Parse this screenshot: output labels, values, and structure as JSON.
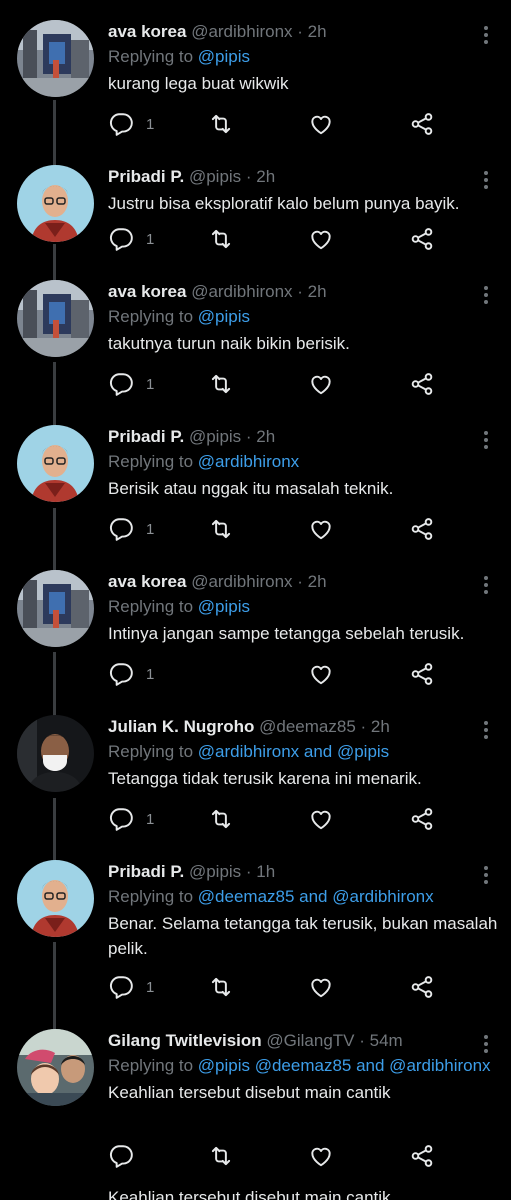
{
  "tweets": [
    {
      "name": "ava korea",
      "handle": "@ardibhironx",
      "sep": " · ",
      "time": "2h",
      "replying_prefix": "Replying to ",
      "replying_to": "@pipis",
      "text": "kurang lega buat wikwik",
      "reply_count": "1",
      "avatar": "street-photo"
    },
    {
      "name": "Pribadi P.",
      "handle": "@pipis",
      "sep": " · ",
      "time": "2h",
      "replying_prefix": "",
      "replying_to": "",
      "text": "Justru bisa eksploratif kalo belum punya bayik.",
      "reply_count": "1",
      "avatar": "man-glasses"
    },
    {
      "name": "ava korea",
      "handle": "@ardibhironx",
      "sep": " · ",
      "time": "2h",
      "replying_prefix": "Replying to ",
      "replying_to": "@pipis",
      "text": "takutnya turun naik bikin berisik.",
      "reply_count": "1",
      "avatar": "street-photo"
    },
    {
      "name": "Pribadi P.",
      "handle": "@pipis",
      "sep": " · ",
      "time": "2h",
      "replying_prefix": "Replying to ",
      "replying_to": "@ardibhironx",
      "text": "Berisik atau nggak itu masalah teknik.",
      "reply_count": "1",
      "avatar": "man-glasses"
    },
    {
      "name": "ava korea",
      "handle": "@ardibhironx",
      "sep": " · ",
      "time": "2h",
      "replying_prefix": "Replying to ",
      "replying_to": "@pipis",
      "text": "Intinya jangan sampe tetangga sebelah terusik.",
      "reply_count": "1",
      "avatar": "street-photo"
    },
    {
      "name": "Julian K. Nugroho",
      "handle": "@deemaz85",
      "sep": " · ",
      "time": "2h",
      "replying_prefix": "Replying to ",
      "replying_to": "@ardibhironx and @pipis",
      "text": "Tetangga tidak terusik karena ini menarik.",
      "reply_count": "1",
      "avatar": "man-mask"
    },
    {
      "name": "Pribadi P.",
      "handle": "@pipis",
      "sep": " · ",
      "time": "1h",
      "replying_prefix": "Replying to ",
      "replying_to": "@deemaz85 and @ardibhironx",
      "text": "Benar. Selama tetangga tak terusik, bukan masalah pelik.",
      "reply_count": "1",
      "avatar": "man-glasses"
    },
    {
      "name": "Gilang Twitlevision",
      "handle": "@GilangTV",
      "sep": " · ",
      "time": "54m",
      "replying_prefix": "Replying to ",
      "replying_to": "@pipis @deemaz85 and @ardibhironx",
      "text": "Keahlian tersebut disebut main cantik",
      "reply_count": "",
      "avatar": "family-photo"
    }
  ],
  "cutoff_text": "Keahlian tersebut disebut main cantik",
  "colors": {
    "background": "#000000",
    "text": "#e7e9ea",
    "muted": "#71767b",
    "link": "#3d9ee9",
    "thread_line": "#3a3d40"
  },
  "icons": [
    "reply-icon",
    "retweet-icon",
    "like-icon",
    "share-icon",
    "more-icon"
  ]
}
